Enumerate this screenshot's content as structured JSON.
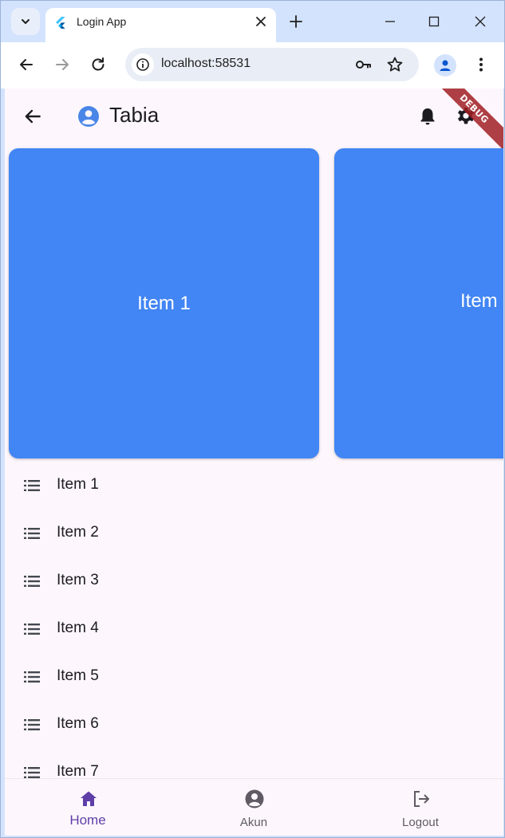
{
  "browser": {
    "tab_title": "Login App",
    "url": "localhost:58531"
  },
  "app": {
    "title": "Tabia",
    "debug_banner": "DEBUG",
    "carousel": [
      "Item 1",
      "Item"
    ],
    "list": [
      "Item 1",
      "Item 2",
      "Item 3",
      "Item 4",
      "Item 5",
      "Item 6",
      "Item 7"
    ],
    "bottom_nav": {
      "home": "Home",
      "akun": "Akun",
      "logout": "Logout",
      "selected": "home"
    }
  },
  "colors": {
    "card": "#4285f4",
    "accent": "#5f3ea8",
    "app_background": "#fdf7fd",
    "browser_chrome": "#d3e3fd"
  },
  "icons": {
    "appbar": [
      "back-arrow-icon",
      "account-circle-icon",
      "bell-icon",
      "settings-gear-icon"
    ],
    "list_item": "list-bullets-icon",
    "bottom_nav": [
      "home-icon",
      "account-circle-icon",
      "logout-icon"
    ]
  }
}
